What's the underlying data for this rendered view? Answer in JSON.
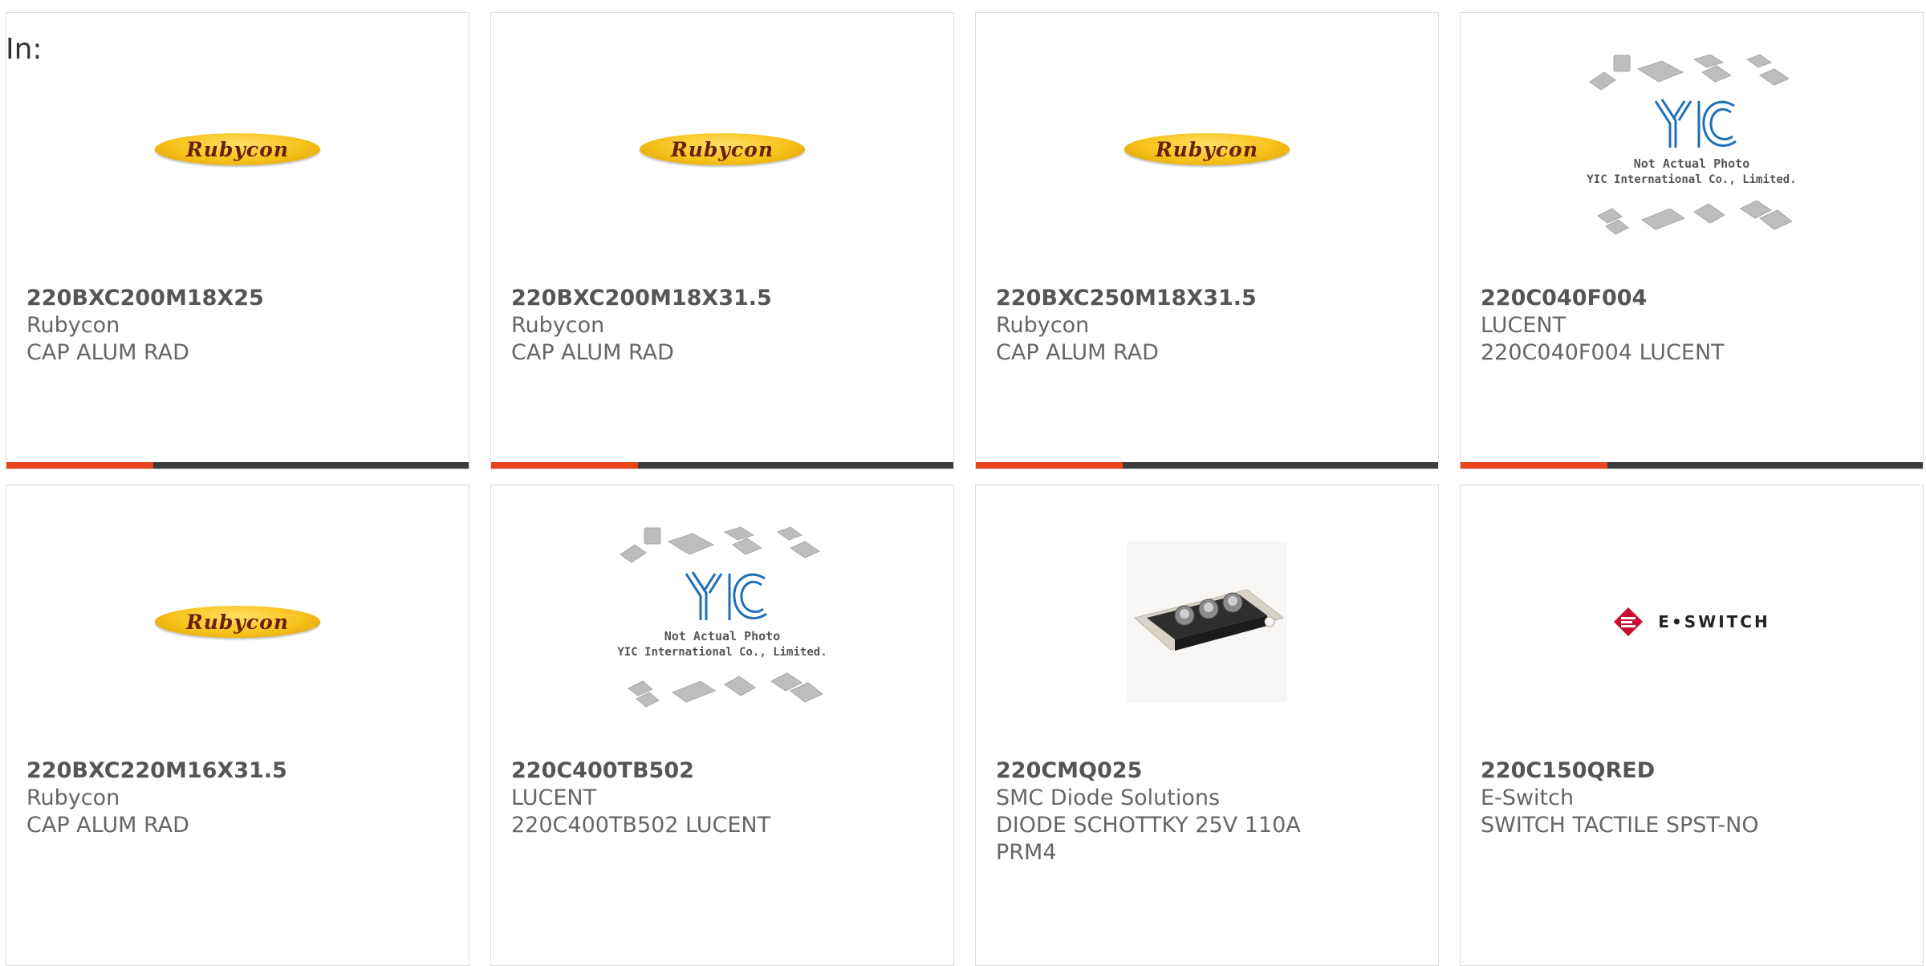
{
  "filter": {
    "label": "In:"
  },
  "products": [
    {
      "part": "220BXC200M18X25",
      "manufacturer": "Rubycon",
      "description": "CAP ALUM RAD",
      "image": "rubycon-logo"
    },
    {
      "part": "220BXC200M18X31.5",
      "manufacturer": "Rubycon",
      "description": "CAP ALUM RAD",
      "image": "rubycon-logo"
    },
    {
      "part": "220BXC250M18X31.5",
      "manufacturer": "Rubycon",
      "description": "CAP ALUM RAD",
      "image": "rubycon-logo"
    },
    {
      "part": "220C040F004",
      "manufacturer": "LUCENT",
      "description": "220C040F004 LUCENT",
      "image": "yic-placeholder"
    },
    {
      "part": "220BXC220M16X31.5",
      "manufacturer": "Rubycon",
      "description": "CAP ALUM RAD",
      "image": "rubycon-logo"
    },
    {
      "part": "220C400TB502",
      "manufacturer": "LUCENT",
      "description": "220C400TB502 LUCENT",
      "image": "yic-placeholder"
    },
    {
      "part": "220CMQ025",
      "manufacturer": "SMC Diode Solutions",
      "description": "DIODE SCHOTTKY 25V 110A PRM4",
      "image": "diode-photo"
    },
    {
      "part": "220C150QRED",
      "manufacturer": "E-Switch",
      "description": "SWITCH TACTILE SPST-NO",
      "image": "eswitch-logo"
    }
  ],
  "logos": {
    "rubycon": "Rubycon",
    "yic_line1": "Not Actual Photo",
    "yic_line2": "YIC International Co., Limited.",
    "eswitch": "E•SWITCH"
  },
  "colors": {
    "accent": "#e8431a",
    "bar": "#3c3c3c",
    "border": "#dcdcdc",
    "rubycon_yellow": "#f7c21b",
    "yic_blue": "#1f6fb8",
    "eswitch_red": "#c8102e"
  }
}
